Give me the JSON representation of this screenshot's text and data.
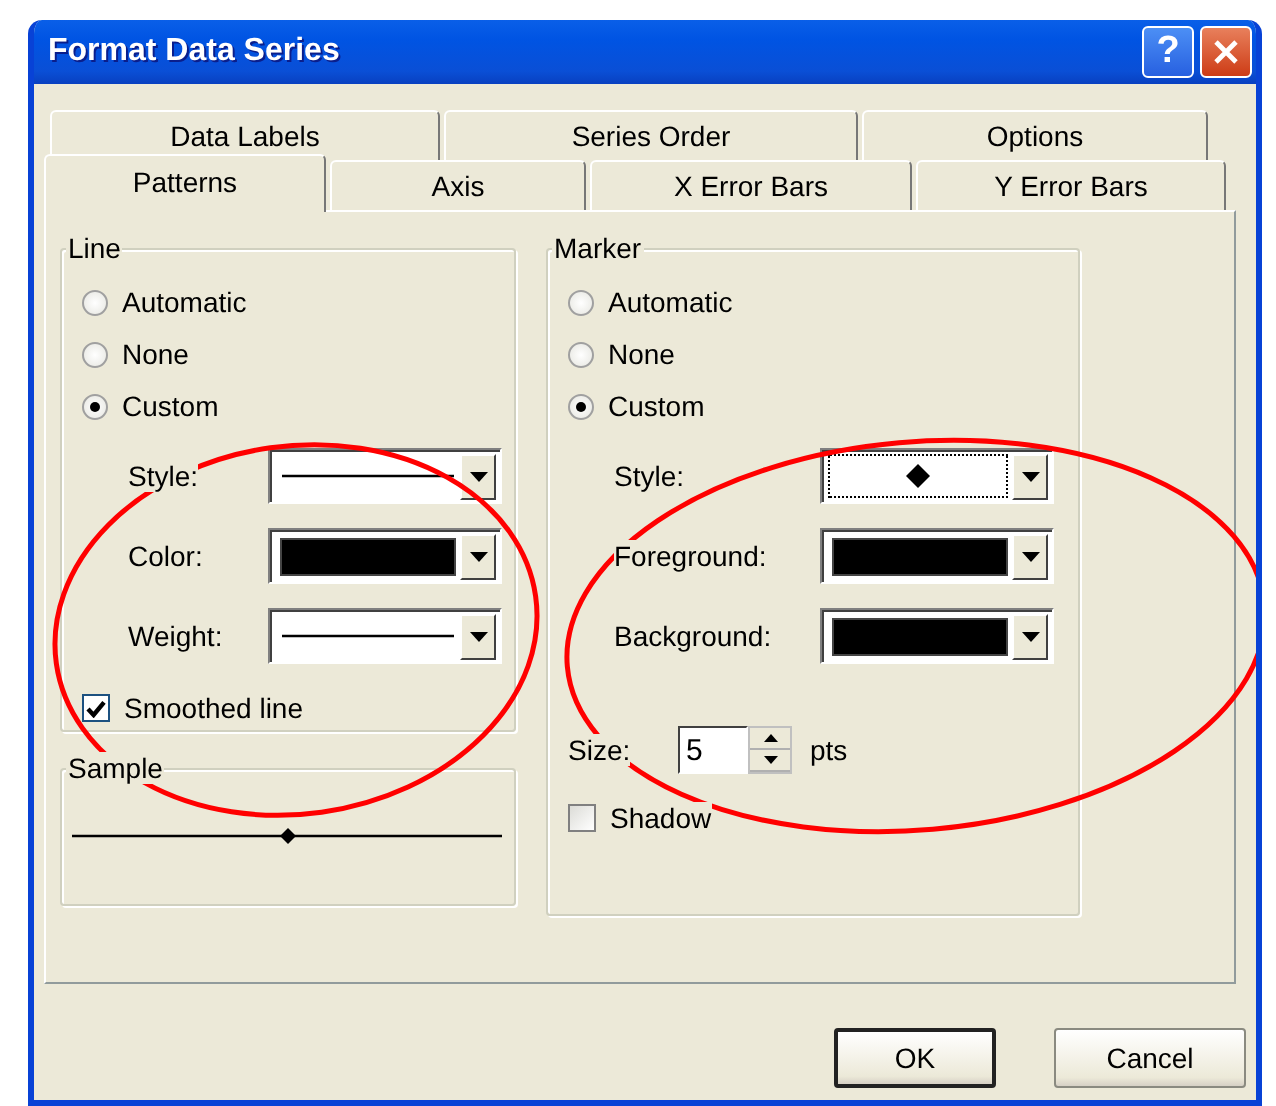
{
  "window": {
    "title": "Format Data Series",
    "help_label": "?"
  },
  "tab_rows": [
    [
      {
        "label": "Data Labels",
        "selected": false
      },
      {
        "label": "Series Order",
        "selected": false
      },
      {
        "label": "Options",
        "selected": false
      }
    ],
    [
      {
        "label": "Patterns",
        "selected": true
      },
      {
        "label": "Axis",
        "selected": false
      },
      {
        "label": "X Error Bars",
        "selected": false
      },
      {
        "label": "Y Error Bars",
        "selected": false
      }
    ]
  ],
  "line": {
    "title": "Line",
    "options": [
      {
        "label": "Automatic",
        "selected": false
      },
      {
        "label": "None",
        "selected": false
      },
      {
        "label": "Custom",
        "selected": true
      }
    ],
    "fields": [
      {
        "label": "Style:",
        "kind": "line"
      },
      {
        "label": "Color:",
        "kind": "color",
        "color": "#000000"
      },
      {
        "label": "Weight:",
        "kind": "line"
      }
    ],
    "smoothed": {
      "label": "Smoothed line",
      "checked": true
    }
  },
  "sample": {
    "title": "Sample"
  },
  "marker": {
    "title": "Marker",
    "options": [
      {
        "label": "Automatic",
        "selected": false
      },
      {
        "label": "None",
        "selected": false
      },
      {
        "label": "Custom",
        "selected": true
      }
    ],
    "fields": [
      {
        "label": "Style:",
        "kind": "marker"
      },
      {
        "label": "Foreground:",
        "kind": "color",
        "color": "#000000"
      },
      {
        "label": "Background:",
        "kind": "color",
        "color": "#000000"
      }
    ],
    "size": {
      "label": "Size:",
      "value": "5",
      "unit": "pts"
    },
    "shadow": {
      "label": "Shadow",
      "checked": false
    }
  },
  "buttons": [
    {
      "label": "OK",
      "default": true
    },
    {
      "label": "Cancel",
      "default": false
    }
  ],
  "annotations": [
    {
      "kind": "ellipse",
      "color": "#ff0000"
    },
    {
      "kind": "ellipse",
      "color": "#ff0000"
    }
  ]
}
